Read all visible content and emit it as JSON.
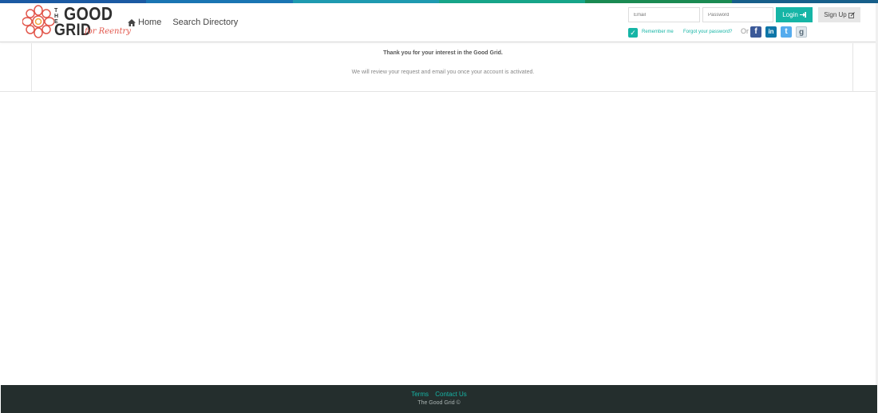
{
  "colors": {
    "accent": "#16b5a6",
    "footer_bg": "#242e2d",
    "stripe": [
      "#1b5aa3",
      "#1a75b3",
      "#1e9ab0",
      "#17a589",
      "#1a8a52",
      "#175f8a"
    ]
  },
  "logo": {
    "the": "THE",
    "good": "GOOD",
    "grid": "GRID",
    "tagline": "for Reentry"
  },
  "nav": {
    "home": "Home",
    "search_directory": "Search Directory"
  },
  "login": {
    "email_placeholder": "Email",
    "password_placeholder": "Password",
    "login_label": "Login",
    "signup_label": "Sign Up",
    "remember_me": "Remember me",
    "forgot_password": "Forgot your password?",
    "or": "Or",
    "social": {
      "facebook": "f",
      "linkedin": "in",
      "twitter": "t",
      "google": "g"
    }
  },
  "main": {
    "thank_you": "Thank you for your interest in the Good Grid.",
    "review": "We will review your request and email you once your account is activated."
  },
  "footer": {
    "terms": "Terms",
    "contact": "Contact Us",
    "copyright": "The Good Grid ©"
  }
}
